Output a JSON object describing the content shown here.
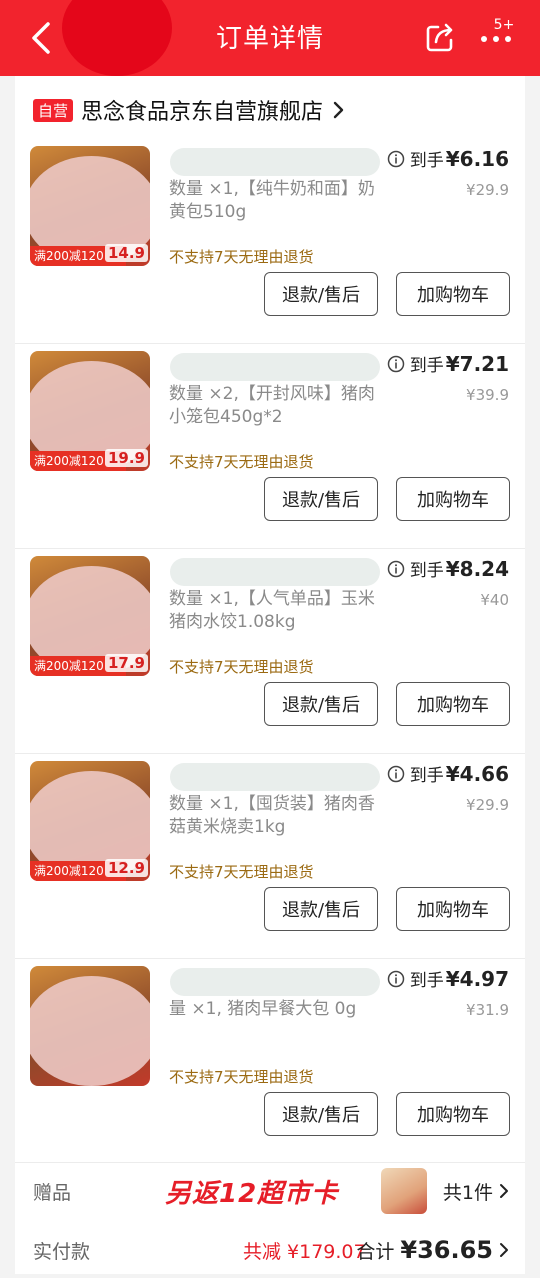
{
  "header": {
    "title": "订单详情",
    "badge": "5+"
  },
  "shop": {
    "tag": "自营",
    "name": "思念食品京东自营旗舰店"
  },
  "items": [
    {
      "desc": "数量 ×1,【纯牛奶和面】奶黄包510g",
      "daoshou_label": "到手",
      "daoshou_price": "¥6.16",
      "orig_price": "¥29.9",
      "return_note": "不支持7天无理由退货",
      "thumb_price": "14.9",
      "thumb_promo": "满200减120",
      "refund_label": "退款/售后",
      "cart_label": "加购物车"
    },
    {
      "desc": "数量 ×2,【开封风味】猪肉小笼包450g*2",
      "daoshou_label": "到手",
      "daoshou_price": "¥7.21",
      "orig_price": "¥39.9",
      "return_note": "不支持7天无理由退货",
      "thumb_price": "19.9",
      "thumb_promo": "满200减120",
      "refund_label": "退款/售后",
      "cart_label": "加购物车"
    },
    {
      "desc": "数量 ×1,【人气单品】玉米猪肉水饺1.08kg",
      "daoshou_label": "到手",
      "daoshou_price": "¥8.24",
      "orig_price": "¥40",
      "return_note": "不支持7天无理由退货",
      "thumb_price": "17.9",
      "thumb_promo": "满200减120",
      "refund_label": "退款/售后",
      "cart_label": "加购物车"
    },
    {
      "desc": "数量 ×1,【囤货装】猪肉香菇黄米烧卖1kg",
      "daoshou_label": "到手",
      "daoshou_price": "¥4.66",
      "orig_price": "¥29.9",
      "return_note": "不支持7天无理由退货",
      "thumb_price": "12.9",
      "thumb_promo": "满200减120",
      "refund_label": "退款/售后",
      "cart_label": "加购物车"
    },
    {
      "desc": "量 ×1, 猪肉早餐大包 0g",
      "daoshou_label": "到手",
      "daoshou_price": "¥4.97",
      "orig_price": "¥31.9",
      "return_note": "不支持7天无理由退货",
      "thumb_price": "",
      "thumb_promo": "",
      "refund_label": "退款/售后",
      "cart_label": "加购物车"
    }
  ],
  "gift": {
    "label": "赠品",
    "banner": "另返12超市卡",
    "count": "共1件"
  },
  "paid": {
    "label": "实付款",
    "reduce": "共减 ¥179.07",
    "total_label": "合计",
    "total_value": "¥36.65"
  }
}
